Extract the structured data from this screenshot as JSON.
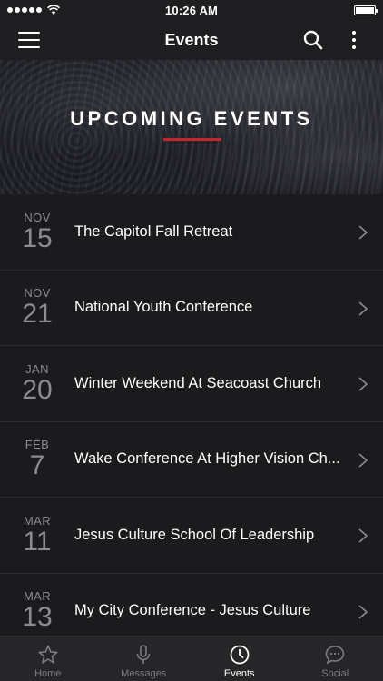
{
  "status_bar": {
    "time": "10:26 AM"
  },
  "nav": {
    "title": "Events"
  },
  "hero": {
    "title": "UPCOMING EVENTS",
    "accent_color": "#c3262e"
  },
  "events": [
    {
      "month": "NOV",
      "day": "15",
      "title": "The Capitol Fall Retreat"
    },
    {
      "month": "NOV",
      "day": "21",
      "title": "National Youth Conference"
    },
    {
      "month": "JAN",
      "day": "20",
      "title": "Winter Weekend At Seacoast Church"
    },
    {
      "month": "FEB",
      "day": "7",
      "title": "Wake Conference At Higher Vision Ch..."
    },
    {
      "month": "MAR",
      "day": "11",
      "title": "Jesus Culture School Of Leadership"
    },
    {
      "month": "MAR",
      "day": "13",
      "title": "My City Conference - Jesus Culture"
    }
  ],
  "tabs": [
    {
      "label": "Home",
      "icon": "star-icon"
    },
    {
      "label": "Messages",
      "icon": "microphone-icon"
    },
    {
      "label": "Events",
      "icon": "clock-icon",
      "active": true
    },
    {
      "label": "Social",
      "icon": "chat-bubble-icon"
    }
  ]
}
